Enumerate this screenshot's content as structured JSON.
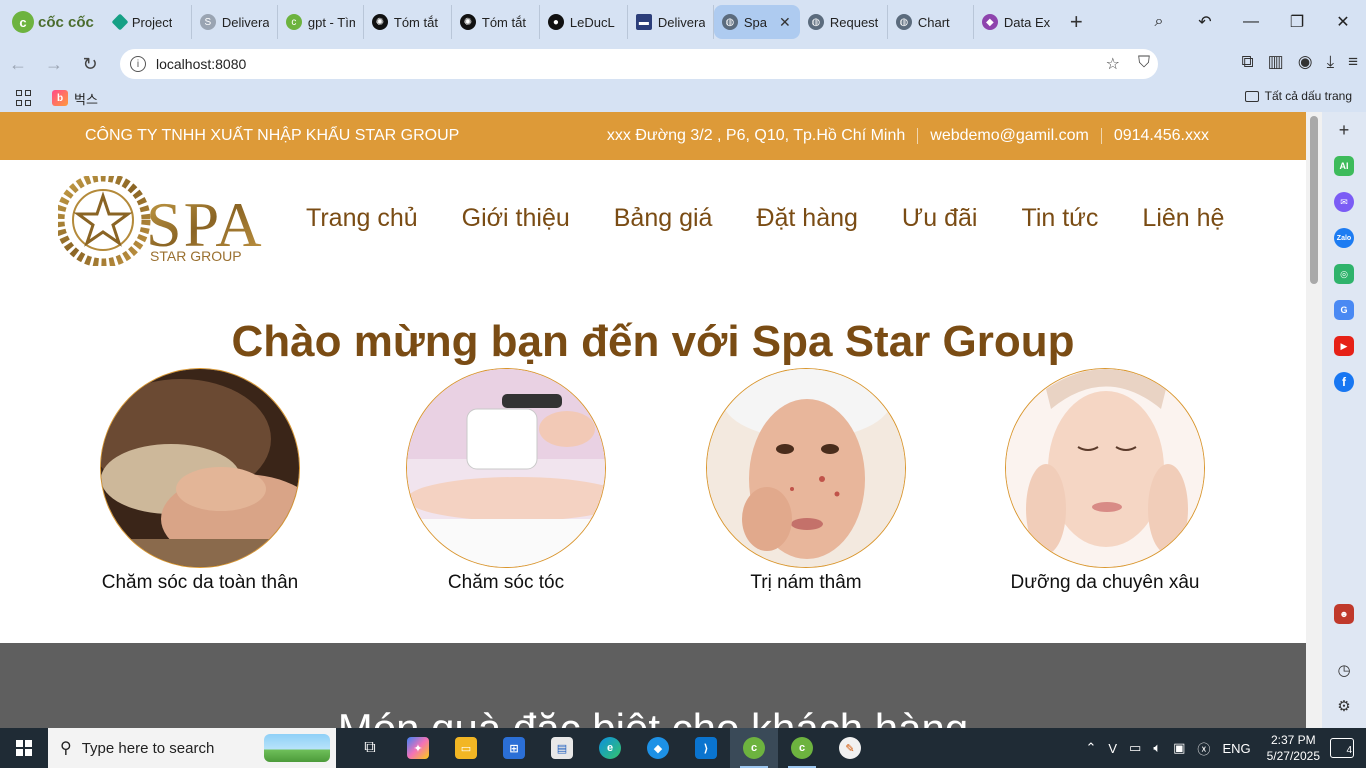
{
  "browser": {
    "brand_name": "cốc cốc",
    "tabs": [
      {
        "title": "Project",
        "color": "#16a085"
      },
      {
        "title": "Delivera",
        "color": "#9aa4b2"
      },
      {
        "title": "gpt - Tìm",
        "color": "#6db33f"
      },
      {
        "title": "Tóm tắt",
        "color": "#111111"
      },
      {
        "title": "Tóm tắt",
        "color": "#111111"
      },
      {
        "title": "LeDucL",
        "color": "#111111"
      },
      {
        "title": "Delivera",
        "color": "#2c3e7a"
      },
      {
        "title": "Spa",
        "color": "#5b6b7d",
        "active": true,
        "close": "✕"
      },
      {
        "title": "Request",
        "color": "#5b6b7d"
      },
      {
        "title": "Chart",
        "color": "#5b6b7d"
      },
      {
        "title": "Data Ex",
        "color": "#8e44ad"
      }
    ],
    "new_tab": "+",
    "url": "localhost:8080",
    "bookmark_label": "벅스",
    "all_bookmarks": "Tất cả dấu trang"
  },
  "page": {
    "company": "CÔNG TY TNHH XUẤT NHẬP KHẨU STAR GROUP",
    "address": "xxx Đường 3/2 , P6, Q10, Tp.Hồ Chí Minh",
    "email": "webdemo@gamil.com",
    "phone": "0914.456.xxx",
    "logo": {
      "main": "SPA",
      "sub": "STAR GROUP"
    },
    "nav": [
      "Trang chủ",
      "Giới thiệu",
      "Bảng giá",
      "Đặt hàng",
      "Ưu đãi",
      "Tin tức",
      "Liên hệ"
    ],
    "welcome": "Chào mừng bạn đến với Spa Star Group",
    "services": [
      {
        "label": "Chăm sóc da toàn thân",
        "image": "body-massage-photo"
      },
      {
        "label": "Chăm sóc tóc",
        "image": "hair-removal-laser-photo"
      },
      {
        "label": "Trị nám thâm",
        "image": "acne-treatment-photo"
      },
      {
        "label": "Dưỡng da chuyên xâu",
        "image": "facial-skincare-photo"
      }
    ],
    "gift_title": "Món quà đặc biệt cho khách hàng"
  },
  "taskbar": {
    "search_placeholder": "Type here to search",
    "language": "ENG",
    "time": "2:37 PM",
    "date": "5/27/2025",
    "notifications": "4"
  },
  "colors": {
    "accent": "#dd9a38",
    "brown_text": "#7a4c14",
    "gift_bg": "#5f5f5f"
  }
}
